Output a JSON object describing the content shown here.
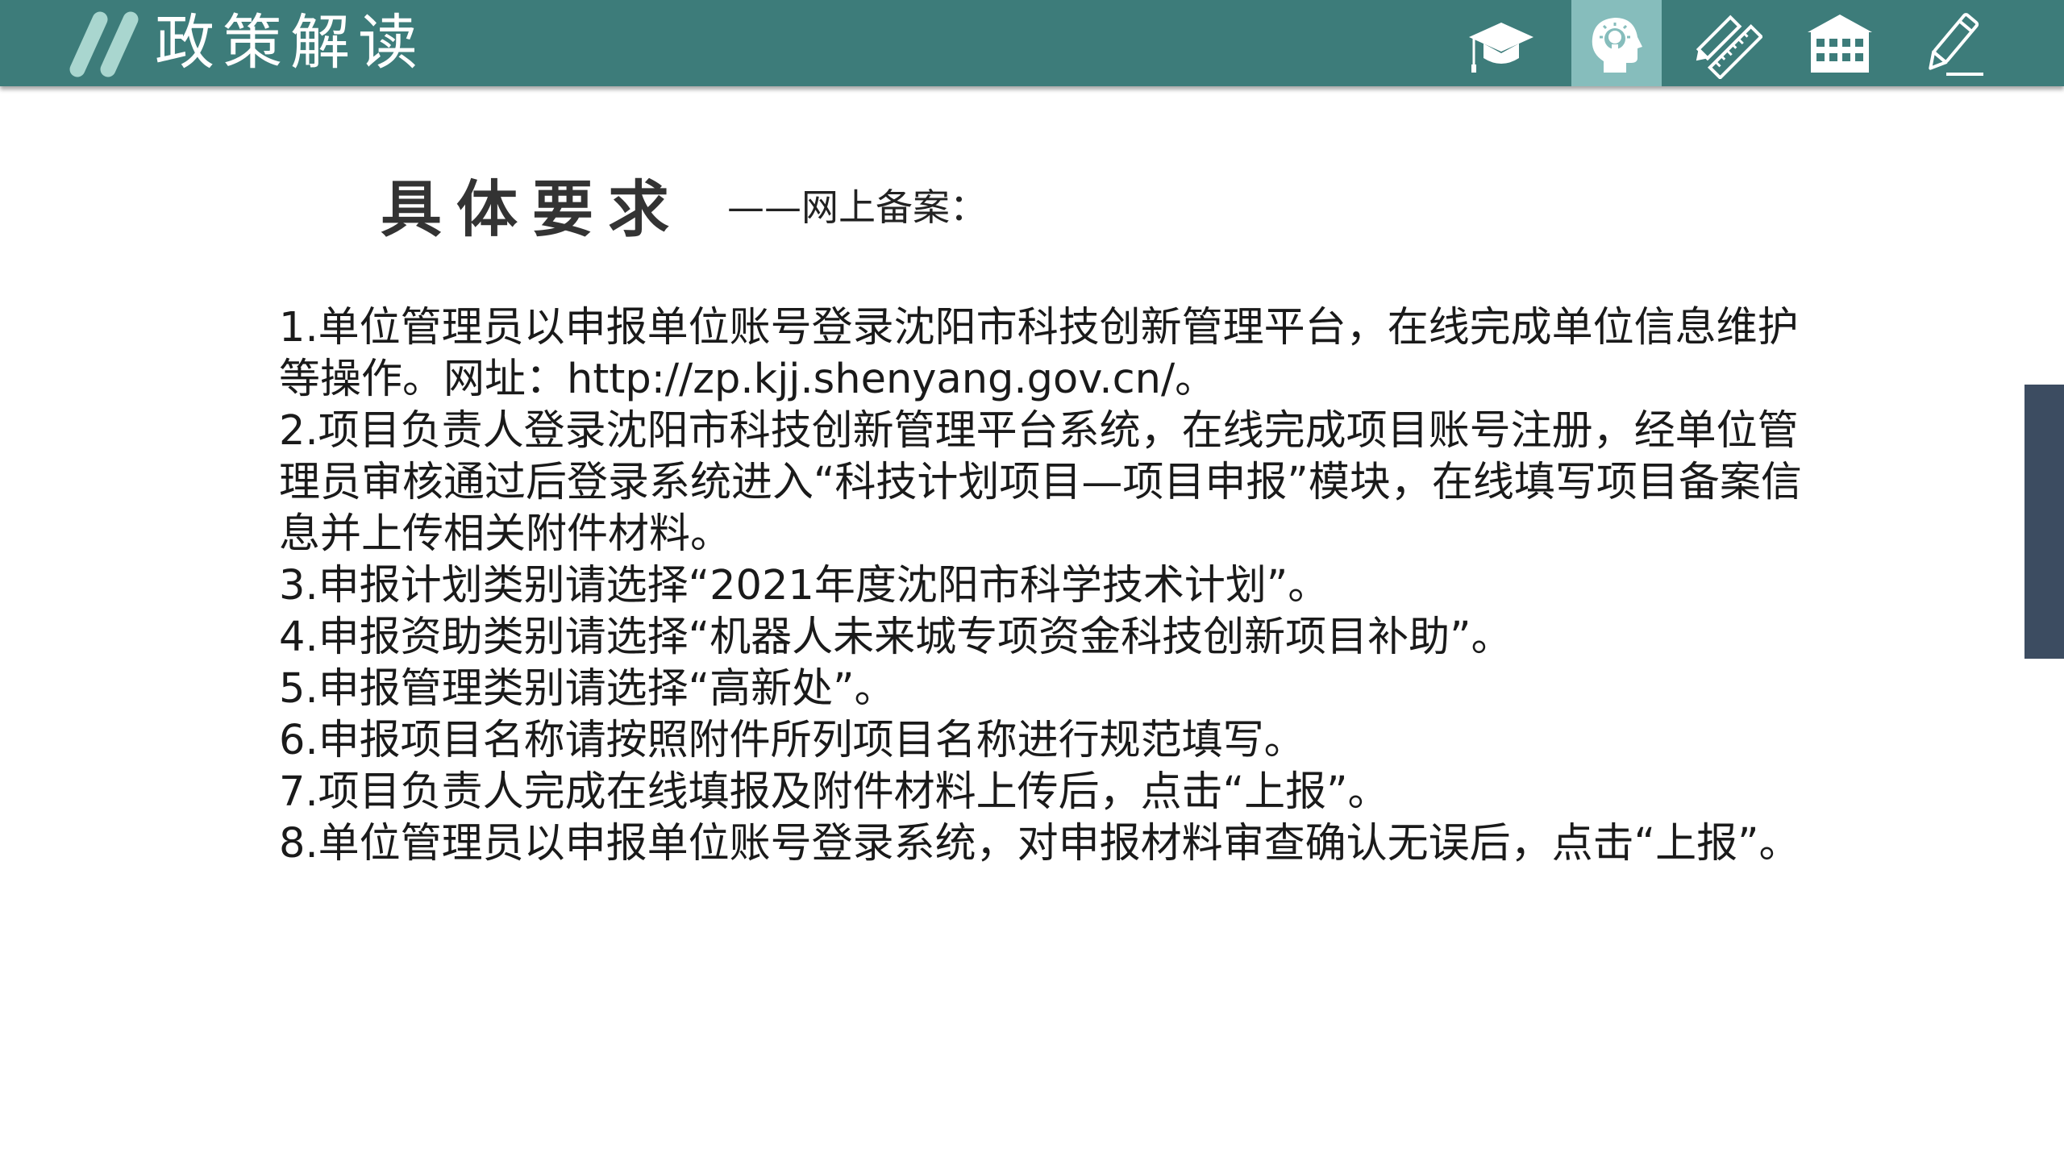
{
  "header": {
    "title": "政策解读",
    "nav": [
      {
        "id": "graduation-cap-icon",
        "active": false
      },
      {
        "id": "head-lightbulb-icon",
        "active": true
      },
      {
        "id": "ruler-pencil-icon",
        "active": false
      },
      {
        "id": "school-building-icon",
        "active": false
      },
      {
        "id": "pencil-icon",
        "active": false
      }
    ]
  },
  "colors": {
    "header_bg": "#3d7c7a",
    "header_active": "#86bdbc",
    "side_tab": "#3c4c61",
    "text": "#1a1a1a"
  },
  "main": {
    "title": "具体要求",
    "subtitle": "——网上备案：",
    "items": [
      "1.单位管理员以申报单位账号登录沈阳市科技创新管理平台，在线完成单位信息维护等操作。网址：http://zp.kjj.shenyang.gov.cn/。",
      "2.项目负责人登录沈阳市科技创新管理平台系统，在线完成项目账号注册，经单位管理员审核通过后登录系统进入“科技计划项目—项目申报”模块，在线填写项目备案信息并上传相关附件材料。",
      "3.申报计划类别请选择“2021年度沈阳市科学技术计划”。",
      "4.申报资助类别请选择“机器人未来城专项资金科技创新项目补助”。",
      "5.申报管理类别请选择“高新处”。",
      "6.申报项目名称请按照附件所列项目名称进行规范填写。",
      "7.项目负责人完成在线填报及附件材料上传后，点击“上报”。",
      "8.单位管理员以申报单位账号登录系统，对申报材料审查确认无误后，点击“上报”。"
    ]
  }
}
